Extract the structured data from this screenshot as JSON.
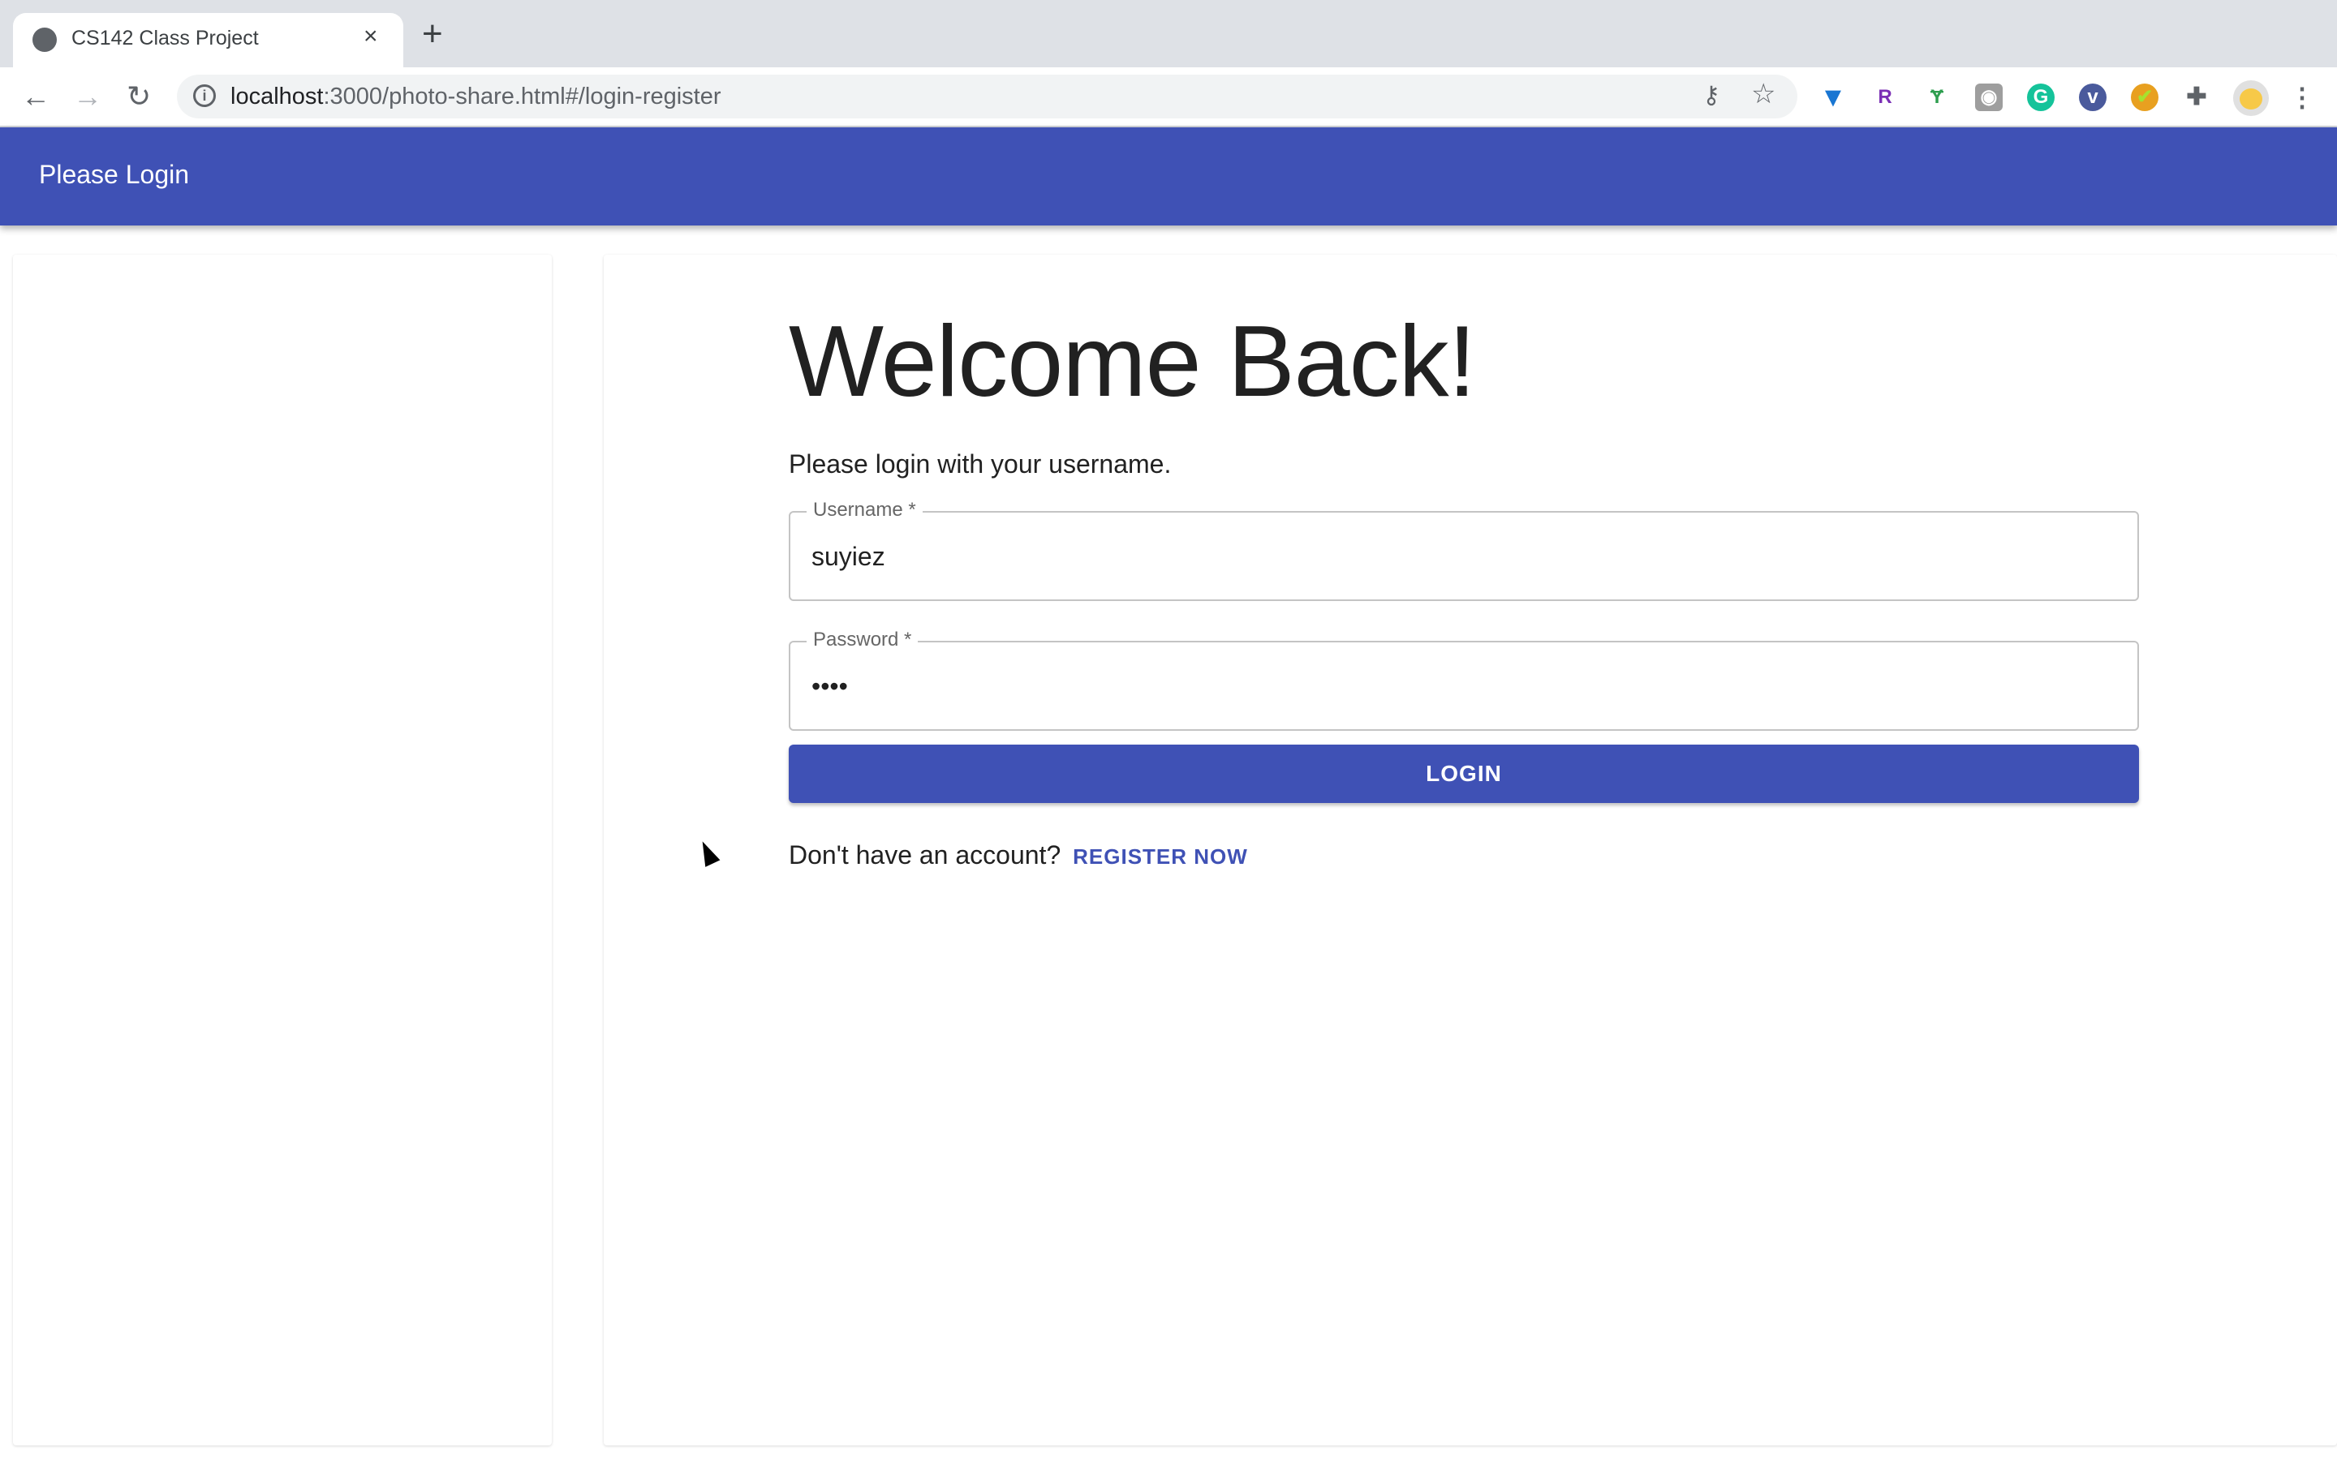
{
  "browser": {
    "tab_title": "CS142 Class Project",
    "tab_close": "×",
    "new_tab": "+",
    "url_host": "localhost",
    "url_rest": ":3000/photo-share.html#/login-register",
    "extensions": [
      "filter-extension-icon",
      "r-extension-icon",
      "hummingbird-extension-icon",
      "camera-extension-icon",
      "grammarly-icon",
      "v-extension-icon",
      "checkmark-extension-icon",
      "puzzle-extensions-icon",
      "profile-avatar",
      "kebab-menu-icon"
    ]
  },
  "appbar": {
    "title": "Please Login",
    "color": "#3f51b5"
  },
  "login": {
    "heading": "Welcome Back!",
    "subtitle": "Please login with your username.",
    "username_label": "Username *",
    "username_value": "suyiez",
    "password_label": "Password *",
    "password_value": "••••",
    "login_button": "LOGIN",
    "register_prompt": "Don't have an account?",
    "register_link": "REGISTER NOW"
  }
}
